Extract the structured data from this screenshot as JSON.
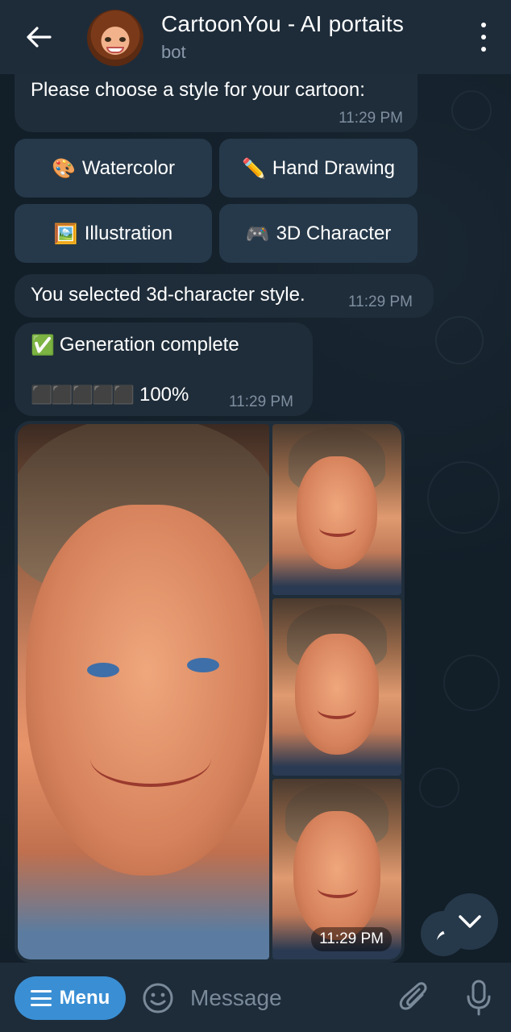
{
  "header": {
    "title": "CartoonYou - AI portaits",
    "subtitle": "bot"
  },
  "messages": {
    "style_prompt": {
      "text": "Please choose a style for your cartoon:",
      "time": "11:29 PM"
    },
    "keyboard": [
      {
        "emoji": "🎨",
        "label": "Watercolor"
      },
      {
        "emoji": "✏️",
        "label": "Hand Drawing"
      },
      {
        "emoji": "🖼️",
        "label": "Illustration"
      },
      {
        "emoji": "🎮",
        "label": "3D Character"
      }
    ],
    "selected": {
      "text": "You selected 3d-character style.",
      "time": "11:29 PM"
    },
    "generation": {
      "title": "Generation complete",
      "check_emoji": "✅",
      "progress_blocks": "⬛⬛⬛⬛⬛",
      "progress_text": "100%",
      "progress_value": 1.0,
      "time": "11:29 PM"
    },
    "image_album": {
      "time": "11:29 PM"
    }
  },
  "input": {
    "menu_label": "Menu",
    "placeholder": "Message"
  },
  "colors": {
    "header_bg": "#1e2c3a",
    "bubble_bg": "#1f2d3a",
    "button_bg": "#26394a",
    "menu_accent": "#3a8fd4",
    "muted_text": "#7f8f9f"
  }
}
